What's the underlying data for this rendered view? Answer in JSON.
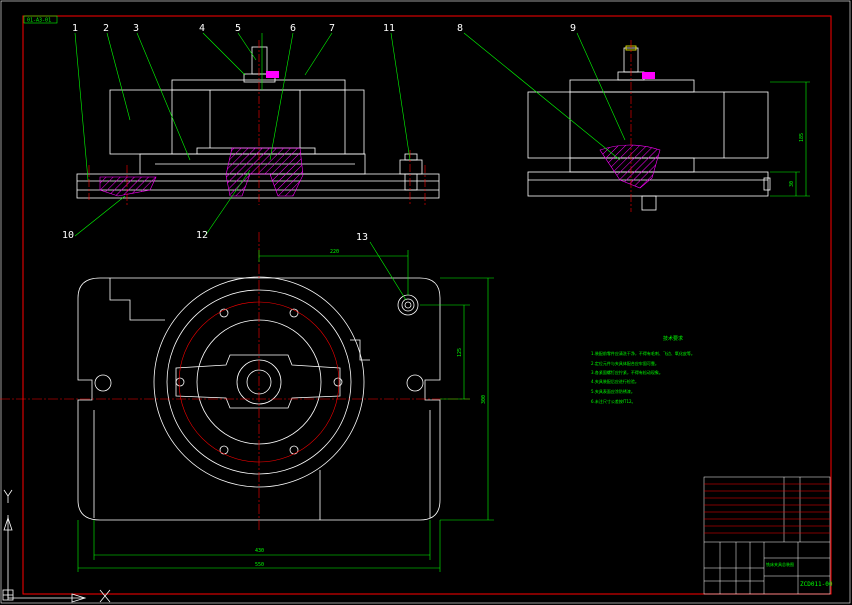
{
  "drawing": {
    "stamp": "01-A3-01",
    "part_labels": [
      "1",
      "2",
      "3",
      "4",
      "5",
      "6",
      "7",
      "11",
      "8",
      "9",
      "10",
      "12",
      "13"
    ],
    "dimensions": {
      "top_width": "220",
      "hole_height": "125",
      "overall_height": "300",
      "inner_width": "430",
      "overall_width": "550",
      "side_height": "185",
      "base_height": "30"
    },
    "notes_title": "技术要求",
    "notes": [
      "1.装配前零件应清洗干净，不得有毛刺、飞边、氧化皮等。",
      "2.定位元件与夹具体配合应牢固可靠。",
      "3.各紧固螺钉应拧紧，不得有松动现象。",
      "4.夹具装配后应进行检验。",
      "5.夹具表面应涂防锈漆。",
      "6.未注尺寸公差按IT12。"
    ],
    "title_block": {
      "drawing_no": "ZCD011-00",
      "name": "铣床夹具总装图"
    },
    "colors": {
      "background": "#000000",
      "outline": "#ffffff",
      "dimension": "#00ff00",
      "centerline": "#ff0000",
      "hatch": "#ff00ff",
      "highlight": "#ffff00"
    }
  }
}
